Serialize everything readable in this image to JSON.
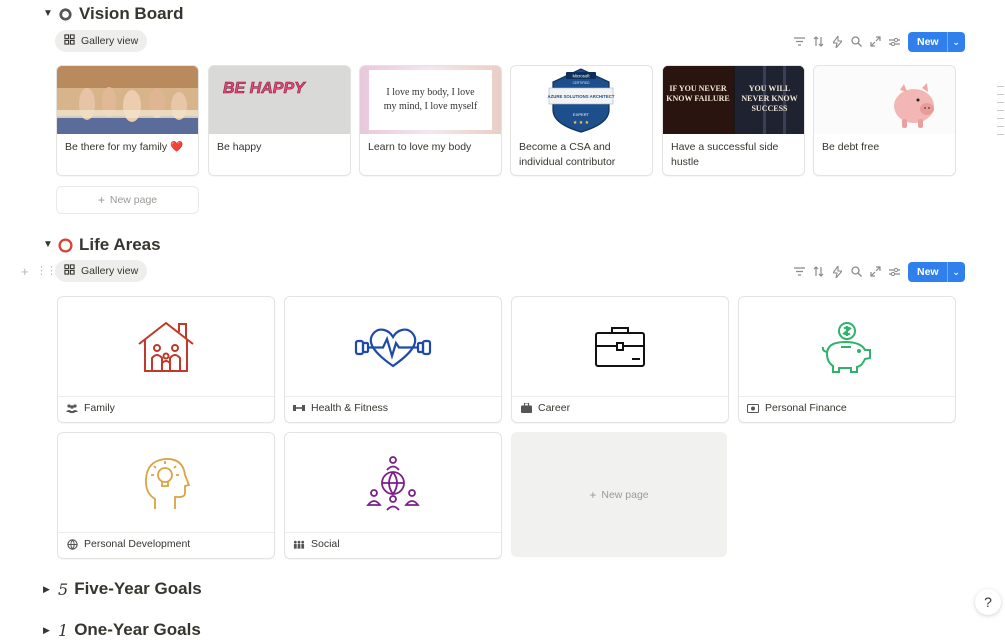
{
  "vision_board": {
    "title": "Vision Board",
    "view_label": "Gallery view",
    "new_label": "New",
    "cards": [
      {
        "title": "Be there for my family ❤️"
      },
      {
        "title": "Be happy",
        "image_text": "BE HAPPY"
      },
      {
        "title": "Learn to love my body",
        "image_text": "I love my body, I love my mind, I love myself"
      },
      {
        "title": "Become a CSA and individual contributor",
        "badge_top": "Microsoft",
        "badge_sub": "CERTIFIED",
        "badge_main": "AZURE SOLUTIONS ARCHITECT",
        "badge_level": "EXPERT"
      },
      {
        "title": "Have a successful side hustle",
        "image_left": "IF YOU NEVER KNOW FAILURE",
        "image_right": "YOU WILL NEVER KNOW SUCCESS"
      },
      {
        "title": "Be debt free"
      }
    ],
    "new_page_label": "New page"
  },
  "life_areas": {
    "title": "Life Areas",
    "view_label": "Gallery view",
    "new_label": "New",
    "cards": [
      {
        "title": "Family",
        "icon": "people-icon",
        "art": "house-family-icon",
        "color": "#c0392b"
      },
      {
        "title": "Health & Fitness",
        "icon": "dumbbell-icon",
        "art": "heart-dumbbell-icon",
        "color": "#1f4aa8"
      },
      {
        "title": "Career",
        "icon": "briefcase-icon",
        "art": "briefcase-icon",
        "color": "#111111"
      },
      {
        "title": "Personal Finance",
        "icon": "money-icon",
        "art": "piggy-bank-icon",
        "color": "#2fb36a"
      },
      {
        "title": "Personal Development",
        "icon": "globe-icon",
        "art": "head-bulb-icon",
        "color": "#d9a441"
      },
      {
        "title": "Social",
        "icon": "group-icon",
        "art": "globe-people-icon",
        "color": "#7a1f8a"
      }
    ],
    "new_page_label": "New page"
  },
  "collapsed_sections": [
    {
      "title": "Five-Year Goals",
      "emoji": "5"
    },
    {
      "title": "One-Year Goals",
      "emoji": "1"
    }
  ],
  "help_glyph": "?"
}
